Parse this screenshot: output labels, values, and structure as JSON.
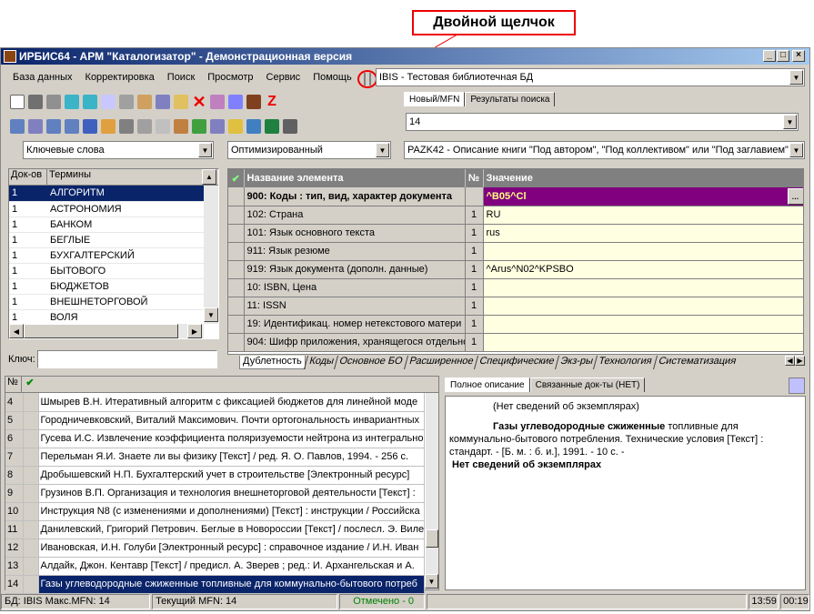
{
  "annotation": {
    "label": "Двойной щелчок"
  },
  "window": {
    "title": "ИРБИС64 - АРМ \"Каталогизатор\" - Демонстрационная версия"
  },
  "menu": [
    "База данных",
    "Корректировка",
    "Поиск",
    "Просмотр",
    "Сервис",
    "Помощь"
  ],
  "database_combo": {
    "value": "IBIS - Тестовая библиотечная БД"
  },
  "mfn_tabs": [
    "Новый/MFN",
    "Результаты поиска"
  ],
  "mfn_field": {
    "value": "14"
  },
  "dict_combo": {
    "value": "Ключевые слова"
  },
  "mode_combo": {
    "value": "Оптимизированный"
  },
  "worksheet_combo": {
    "value": "PAZK42 - Описание книги \"Под автором\", \"Под коллективом\" или \"Под заглавием\""
  },
  "terms": {
    "headers": [
      "Док-ов",
      "Термины"
    ],
    "rows": [
      [
        "1",
        "АЛГОРИТМ"
      ],
      [
        "1",
        "АСТРОНОМИЯ"
      ],
      [
        "1",
        "БАНКОМ"
      ],
      [
        "1",
        "БЕГЛЫЕ"
      ],
      [
        "1",
        "БУХГАЛТЕРСКИЙ"
      ],
      [
        "1",
        "БЫТОВОГО"
      ],
      [
        "1",
        "БЮДЖЕТОВ"
      ],
      [
        "1",
        "ВНЕШНЕТОРГОВОЙ"
      ],
      [
        "1",
        "ВОЛЯ"
      ]
    ],
    "key_label": "Ключ:"
  },
  "fields": {
    "headers": [
      "Название элемента",
      "№",
      "Значение"
    ],
    "rows": [
      [
        "900: Коды : тип, вид, характер документа",
        "",
        "^B05^Cl"
      ],
      [
        "102: Страна",
        "1",
        "RU"
      ],
      [
        "101: Язык основного текста",
        "1",
        "rus"
      ],
      [
        "911: Язык резюме",
        "1",
        ""
      ],
      [
        "919: Язык документа (дополн. данные)",
        "1",
        "^Arus^N02^KPSBO"
      ],
      [
        "10: ISBN, Цена",
        "1",
        ""
      ],
      [
        "11: ISSN",
        "1",
        ""
      ],
      [
        "19: Идентификац. номер нетекстового матери",
        "1",
        ""
      ],
      [
        "904: Шифр приложения, хранящегося отдельно",
        "1",
        ""
      ]
    ]
  },
  "bottom_tabs": [
    "Дублетность",
    "Коды",
    "Основное БО",
    "Расширенное",
    "Специфические",
    "Экз-ры",
    "Технология",
    "Систематизация"
  ],
  "docs": {
    "header_num": "№",
    "rows": [
      [
        "4",
        "Шмырев В.Н. Итеративный алгоритм с фиксацией бюджетов для линейной моде"
      ],
      [
        "5",
        "Городничевковский, Виталий Максимович. Почти ортогональность инвариантных"
      ],
      [
        "6",
        "Гусева И.С. Извлечение коэффициента поляризуемости нейтрона из интегрально"
      ],
      [
        "7",
        "Перельман Я.И. Знаете ли вы физику [Текст] / ред. Я. О. Павлов, 1994. - 256 с."
      ],
      [
        "8",
        "Дробышевский Н.П. Бухгалтерский учет в строительстве [Электронный ресурс]"
      ],
      [
        "9",
        "Грузинов В.П. Организация и технология внешнеторговой деятельности [Текст] :"
      ],
      [
        "10",
        "Инструкция N8   (с изменениями и дополнениями) [Текст] : инструкции / Российска"
      ],
      [
        "11",
        "Данилевский, Григорий Петрович. Беглые в Новороссии [Текст] / послесл. Э. Виле"
      ],
      [
        "12",
        "Ивановская, И.Н. Голуби [Электронный ресурс] : справочное издание / И.Н. Иван"
      ],
      [
        "13",
        "Алдайк, Джон. Кентавр [Текст] / предисл. А. Зверев ; ред.: И. Архангельская и А."
      ],
      [
        "14",
        "Газы углеводородные сжиженные топливные для коммунально-бытового потреб"
      ]
    ]
  },
  "desc_tabs": [
    "Полное описание",
    "Связанные док-ты (НЕТ)"
  ],
  "description": {
    "line1": "(Нет сведений об экземплярах)",
    "title_bold": "Газы углеводородные сжиженные",
    "rest1": " топливные для",
    "line2": "коммунально-бытового потребления. Технические условия [Текст] :",
    "line3": "стандарт. - [Б. м. : б. и.], 1991. - 10 с. -",
    "line4": "Нет сведений об экземплярах"
  },
  "status": {
    "db": "БД: IBIS Макс.MFN: 14",
    "current": "Текущий MFN: 14",
    "marked": "Отмечено - 0",
    "time": "13:59",
    "elapsed": "00:19"
  },
  "colors": {
    "title_start": "#0a246a",
    "title_end": "#a6caf0",
    "selection": "#0a246a",
    "field_highlight": "#800080",
    "value_bg": "#ffffe1",
    "marked": "#008000"
  }
}
